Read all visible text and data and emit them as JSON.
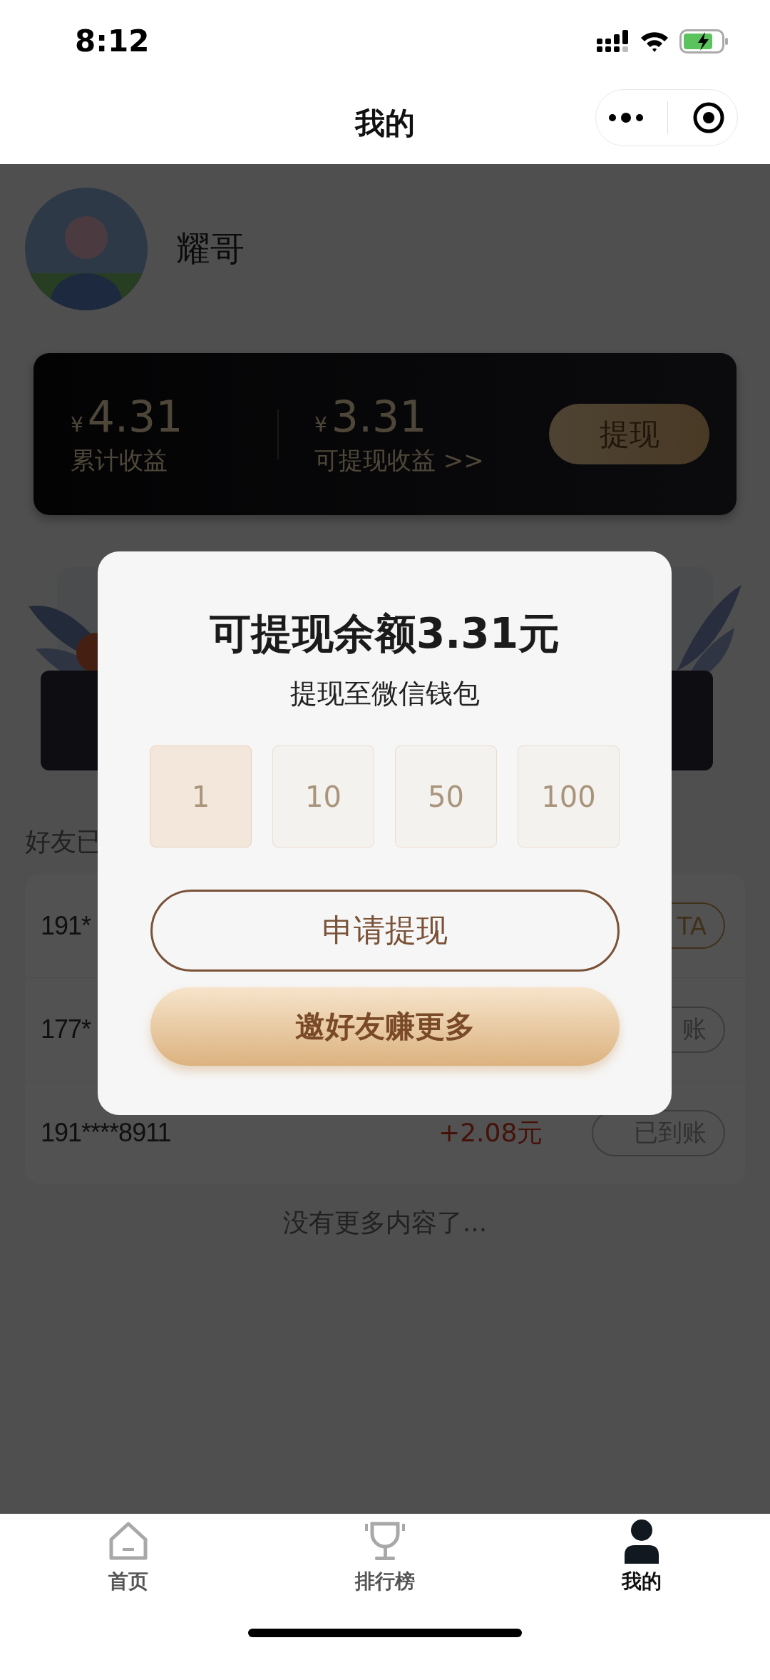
{
  "status_bar": {
    "time": "8:12"
  },
  "header": {
    "title": "我的"
  },
  "profile": {
    "name": "耀哥"
  },
  "earnings": {
    "stats": [
      {
        "currency": "¥",
        "amount": "4.31",
        "label": "累计收益"
      },
      {
        "currency": "¥",
        "amount": "3.31",
        "label": "可提现收益 >>"
      }
    ],
    "button": "提现"
  },
  "friends": {
    "heading": "好友已",
    "rows": [
      {
        "phone": "191*",
        "status": "TA",
        "kind": "invite"
      },
      {
        "phone": "177*",
        "status": "账",
        "kind": "done"
      },
      {
        "phone": "191****8911",
        "amount": "+2.08元",
        "status": "已到账",
        "kind": "done"
      }
    ],
    "footer": "没有更多内容了..."
  },
  "dialog": {
    "title": "可提现余额3.31元",
    "subtitle": "提现至微信钱包",
    "options": [
      {
        "label": "1",
        "selected": true
      },
      {
        "label": "10",
        "selected": false
      },
      {
        "label": "50",
        "selected": false
      },
      {
        "label": "100",
        "selected": false
      }
    ],
    "buttons": [
      {
        "label": "申请提现",
        "kind": "outline"
      },
      {
        "label": "邀好友赚更多",
        "kind": "filled"
      }
    ]
  },
  "tabs": [
    {
      "label": "首页",
      "selected": false
    },
    {
      "label": "排行榜",
      "selected": false
    },
    {
      "label": "我的",
      "selected": true
    }
  ]
}
